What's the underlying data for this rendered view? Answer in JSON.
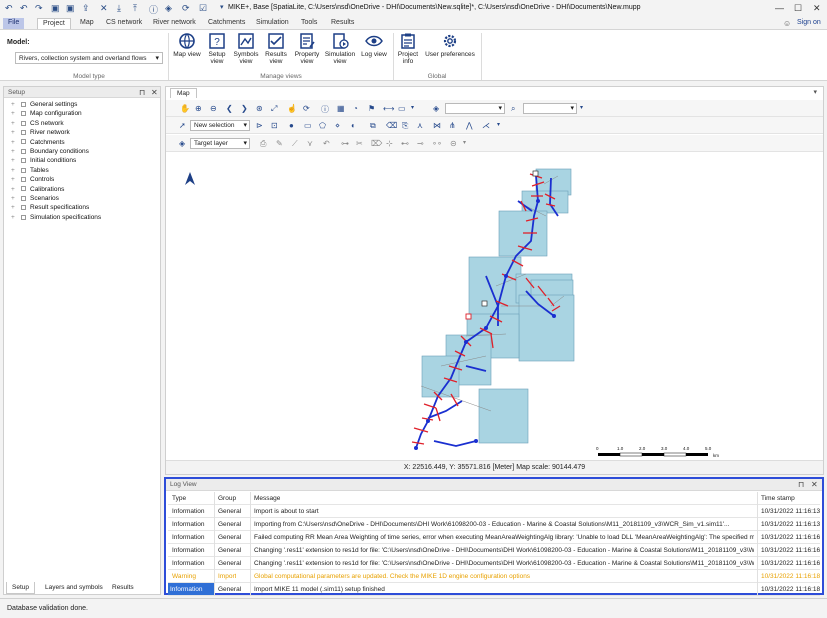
{
  "app": {
    "title": "MIKE+, Base [SpatiaLite, C:\\Users\\nsd\\OneDrive - DHI\\Documents\\New.sqlite]*, C:\\Users\\nsd\\OneDrive - DHI\\Documents\\New.mupp",
    "signin": "Sign on"
  },
  "ribbon_tabs": [
    "File",
    "Project",
    "Map",
    "CS network",
    "River network",
    "Catchments",
    "Simulation",
    "Tools",
    "Results"
  ],
  "model": {
    "label": "Model:",
    "value": "Rivers, collection system and overland flows",
    "group_label": "Model type"
  },
  "ribbon_buttons": {
    "map_view": "Map view",
    "setup_view": "Setup view",
    "symbols_view": "Symbols view",
    "results_view": "Results view",
    "property_view": "Property view",
    "simulation_view": "Simulation view",
    "log_view": "Log view",
    "project_info": "Project info",
    "user_preferences": "User preferences",
    "manage_views_label": "Manage views",
    "global_label": "Global"
  },
  "setup_panel": {
    "title": "Setup",
    "items": [
      "General settings",
      "Map configuration",
      "CS network",
      "River network",
      "Catchments",
      "Boundary conditions",
      "Initial conditions",
      "Tables",
      "Controls",
      "Calibrations",
      "Scenarios",
      "Result specifications",
      "Simulation specifications"
    ],
    "tabs": [
      "Setup",
      "Layers and symbols",
      "Results"
    ]
  },
  "map": {
    "tab": "Map",
    "selection_mode": "New selection",
    "target_layer": "Target layer",
    "coord_text": "X: 22516.449, Y: 35571.816 [Meter]     Map scale: 90144.479",
    "scale_labels": [
      "0",
      "1.0",
      "2.0",
      "3.0",
      "4.0",
      "5.0",
      "km"
    ]
  },
  "log": {
    "title": "Log View",
    "columns": [
      "Type",
      "Group",
      "Message",
      "Time stamp"
    ],
    "rows": [
      {
        "type": "Information",
        "group": "General",
        "message": "Import is about to start",
        "time": "10/31/2022 11:16:13",
        "level": "info"
      },
      {
        "type": "Information",
        "group": "General",
        "message": "Importing from C:\\Users\\nsd\\OneDrive - DHI\\Documents\\DHI Work\\61098200-03 - Education - Marine & Coastal Solutions\\M11_20181109_v3\\WCR_Sim_v1.sim11'...",
        "time": "10/31/2022 11:16:13",
        "level": "info"
      },
      {
        "type": "Information",
        "group": "General",
        "message": "Failed computing RR Mean Area Weighting of time series, error when executing MeanAreaWeightingAlg library: 'Unable to load DLL 'MeanAreaWeightingAlg': The specified module ...",
        "time": "10/31/2022 11:16:16",
        "level": "info"
      },
      {
        "type": "Information",
        "group": "General",
        "message": "Changing '.res11' extension to res1d for file: 'C:\\Users\\nsd\\OneDrive - DHI\\Documents\\DHI Work\\61098200-03 - Education - Marine & Coastal Solutions\\M11_20181109_v3\\WCR_...",
        "time": "10/31/2022 11:16:16",
        "level": "info"
      },
      {
        "type": "Information",
        "group": "General",
        "message": "Changing '.res11' extension to res1d for file: 'C:\\Users\\nsd\\OneDrive - DHI\\Documents\\DHI Work\\61098200-03 - Education - Marine & Coastal Solutions\\M11_20181109_v3\\WCR_...",
        "time": "10/31/2022 11:16:16",
        "level": "info"
      },
      {
        "type": "Warning",
        "group": "Import",
        "message": "Global computational parameters are updated. Check the MIKE 1D engine configuration options",
        "time": "10/31/2022 11:16:18",
        "level": "warn"
      },
      {
        "type": "Information",
        "group": "General",
        "message": "Import MIKE 11 model (.sim11) setup finished",
        "time": "10/31/2022 11:16:18",
        "level": "info",
        "selected": true
      }
    ]
  },
  "status": "Database validation done.",
  "colors": {
    "accent": "#2e4dd8",
    "catchment": "#a9d4e2",
    "river": "#1a2fd0",
    "crosssection": "#e0202a",
    "warning": "#e8a100"
  }
}
